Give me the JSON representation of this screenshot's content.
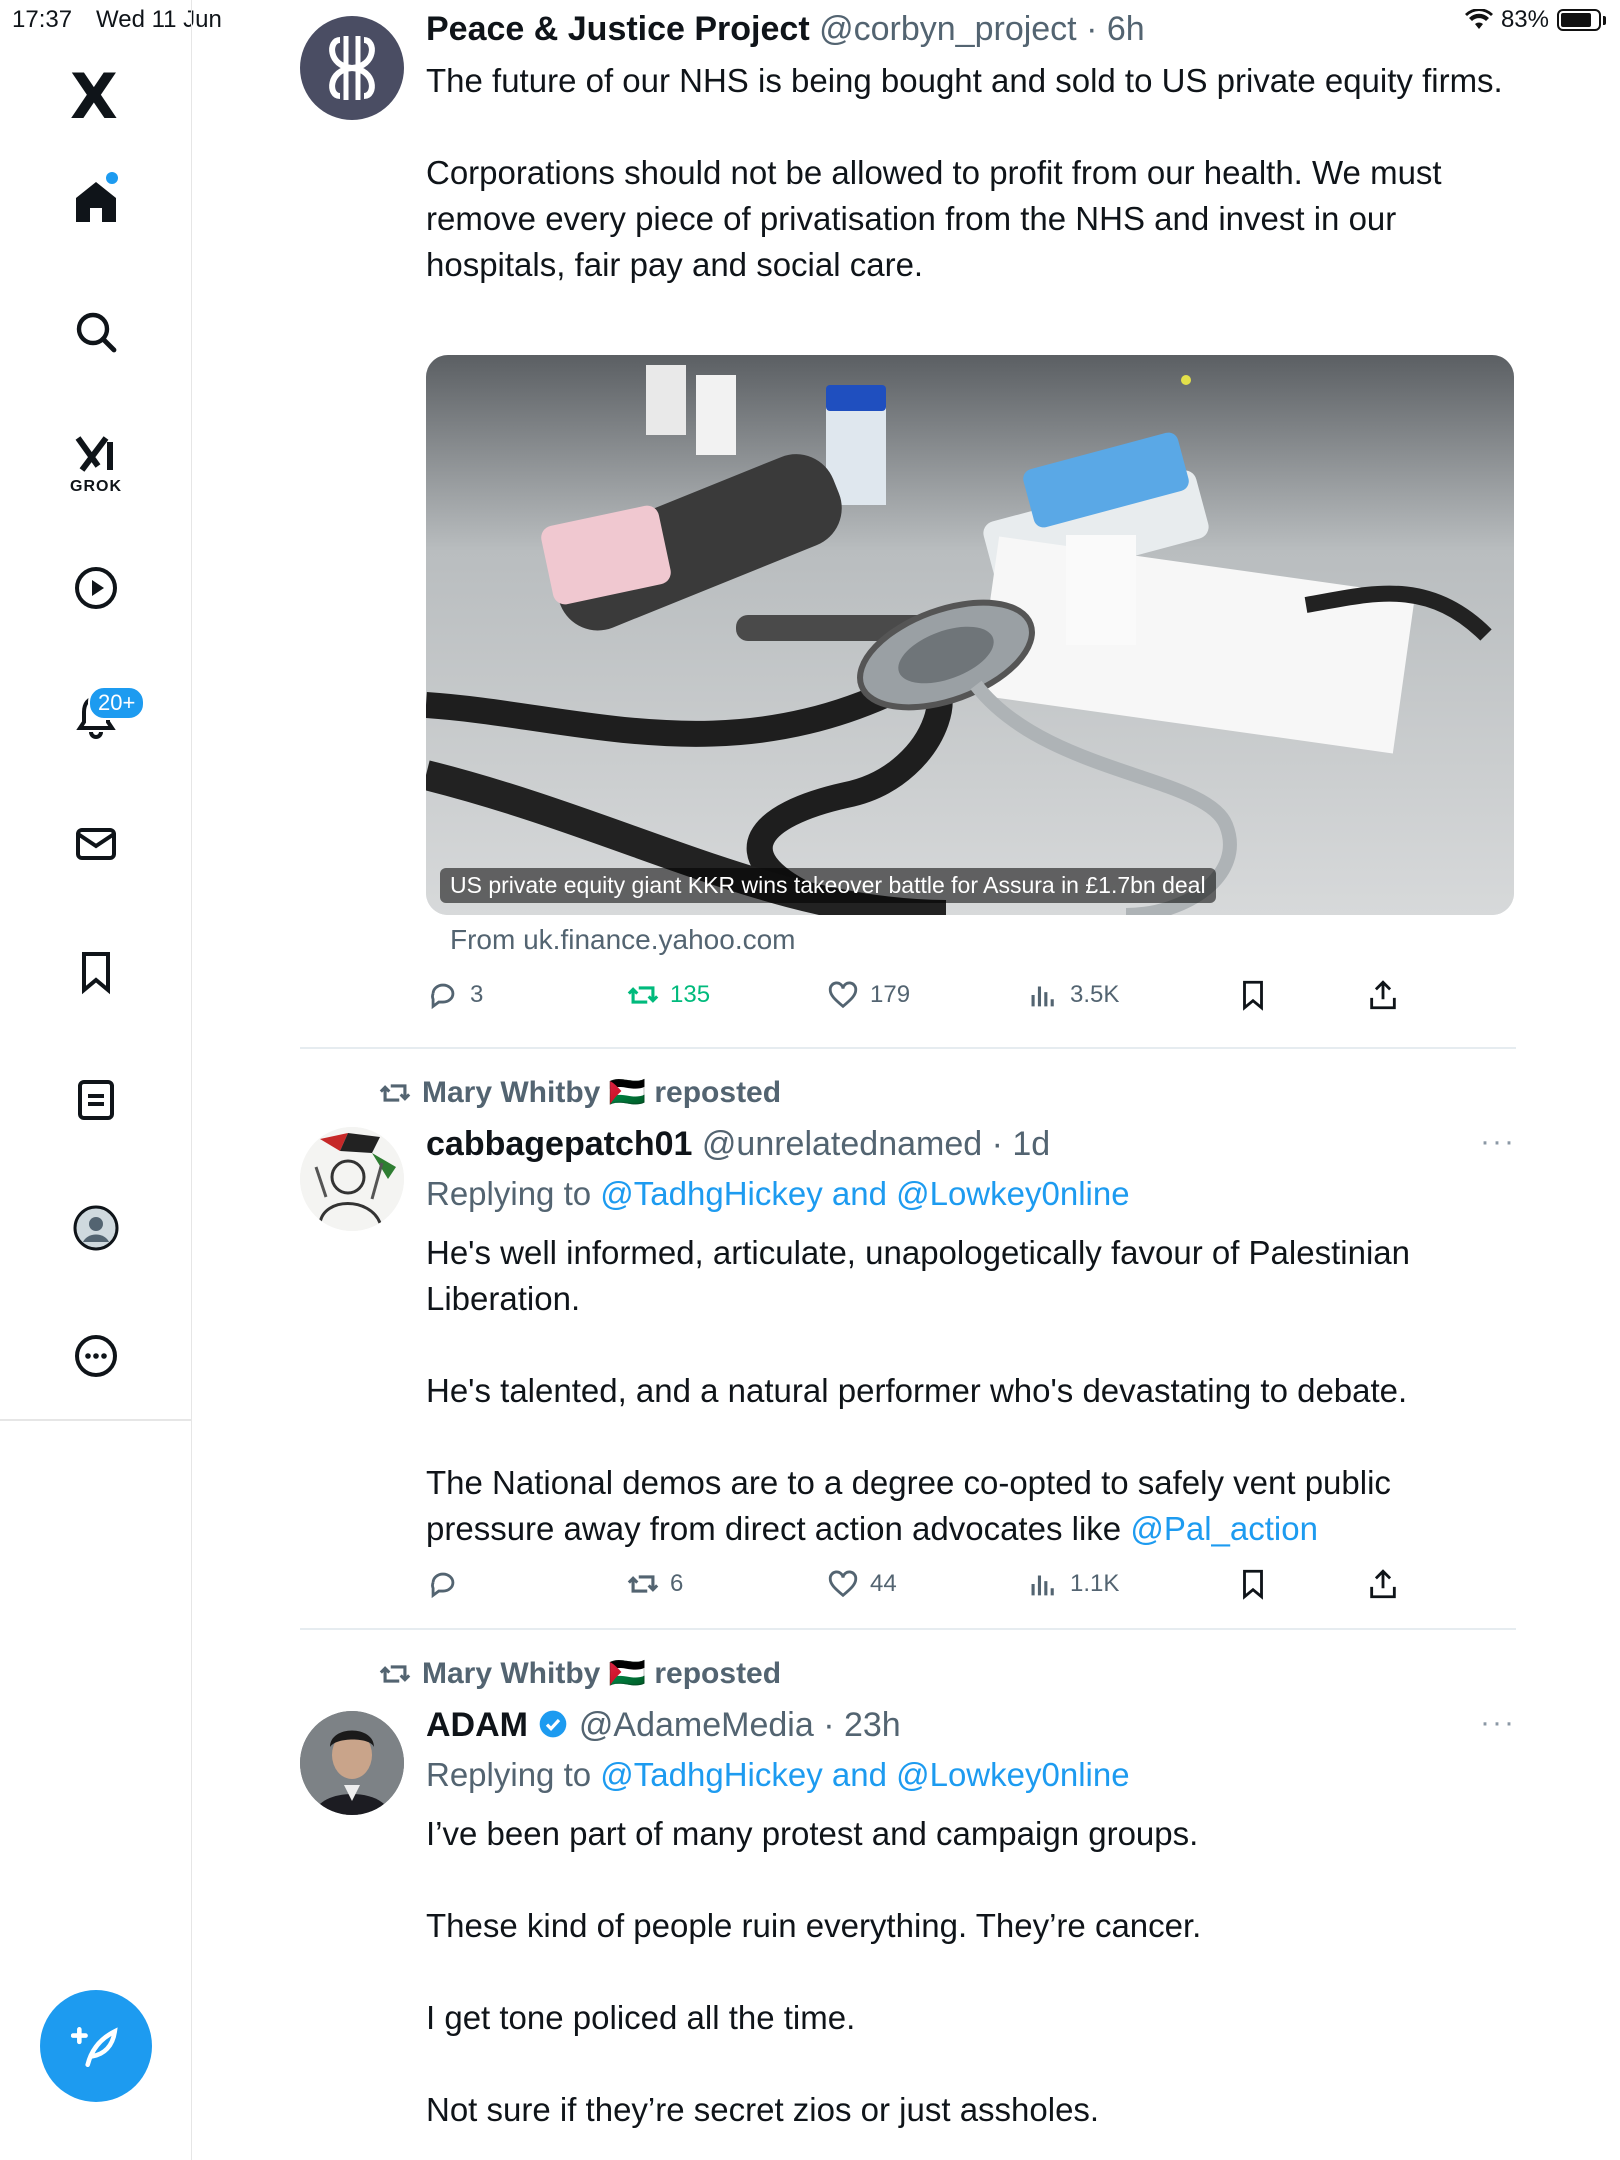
{
  "status_bar": {
    "time": "17:37",
    "date": "Wed 11 Jun",
    "battery": "83%"
  },
  "sidebar": {
    "logo": "X",
    "grok_label": "GROK",
    "notifications_badge": "20+",
    "accent": "#1d9bf0"
  },
  "posts": [
    {
      "name": "Peace & Justice Project",
      "handle": "@corbyn_project",
      "time": "6h",
      "paragraphs": [
        "The future of our NHS is being bought and sold to US private equity firms.",
        "Corporations should not be allowed to profit from our health.  We must remove every piece of privatisation from the NHS and invest in our hospitals, fair pay and social care."
      ],
      "media_caption": "US private equity giant KKR wins takeover battle for Assura in £1.7bn deal",
      "source": "From uk.finance.yahoo.com",
      "stats": {
        "replies": "3",
        "reposts": "135",
        "likes": "179",
        "views": "3.5K"
      }
    },
    {
      "reposted_by": "Mary Whitby 🇵🇸 reposted",
      "name": "cabbagepatch01",
      "handle": "@unrelatednamed",
      "time": "1d",
      "replying_prefix": "Replying to",
      "replying_to": "@TadhgHickey and @Lowkey0nline",
      "paragraphs": [
        "He's well informed, articulate, unapologetically favour of Palestinian Liberation.",
        "He's talented, and a natural performer who's devastating to debate.",
        "The National demos are to a degree co-opted to safely vent public pressure away from direct action advocates like"
      ],
      "mention": "@Pal_action",
      "stats": {
        "replies": "",
        "reposts": "6",
        "likes": "44",
        "views": "1.1K"
      }
    },
    {
      "reposted_by": "Mary Whitby 🇵🇸 reposted",
      "name": "ADAM",
      "handle": "@AdameMedia",
      "time": "23h",
      "replying_prefix": "Replying to",
      "replying_to": "@TadhgHickey and @Lowkey0nline",
      "paragraphs": [
        "I’ve been part of many protest and campaign groups.",
        "These kind of people ruin everything. They’re cancer.",
        "I get tone policed all the time.",
        "Not sure if they’re secret zios or just assholes."
      ]
    }
  ]
}
